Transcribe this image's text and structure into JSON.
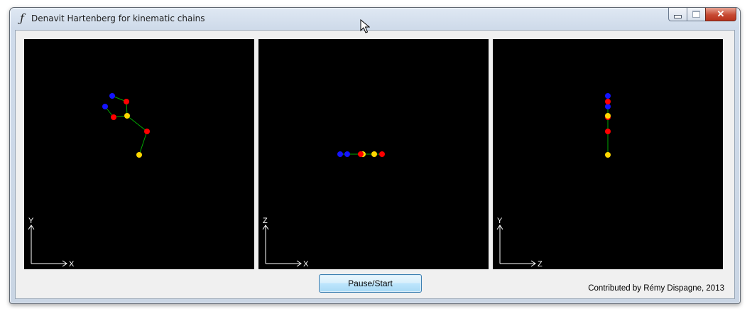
{
  "window": {
    "title": "Denavit Hartenberg for kinematic chains",
    "app_icon": "function-icon",
    "caption_buttons": [
      "minimize",
      "maximize",
      "close"
    ]
  },
  "views": [
    {
      "name": "view-xy",
      "axis_h": "X",
      "axis_v": "Y"
    },
    {
      "name": "view-xz",
      "axis_h": "X",
      "axis_v": "Z"
    },
    {
      "name": "view-zy",
      "axis_h": "Z",
      "axis_v": "Y"
    }
  ],
  "colors": {
    "blue": "#1414ff",
    "red": "#ff0000",
    "yellow": "#ffd700",
    "link": "#00aa00",
    "axis": "#ffffff"
  },
  "controls": {
    "pause_start_label": "Pause/Start"
  },
  "footer": {
    "credit": "Contributed by Rémy Dispagne, 2013"
  }
}
